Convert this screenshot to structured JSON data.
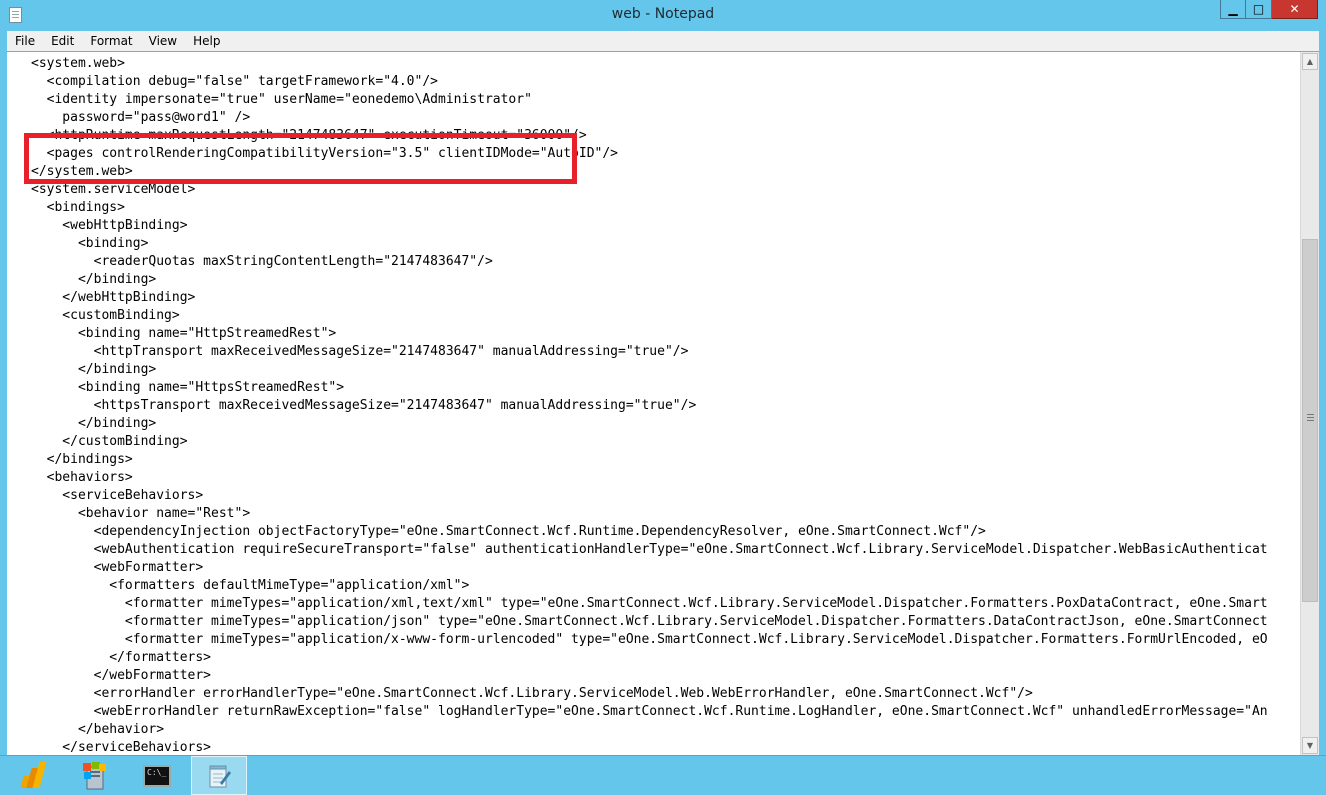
{
  "window": {
    "title": "web - Notepad",
    "controls": {
      "minimize": "▁",
      "maximize": "□",
      "close": "✕"
    }
  },
  "menu": [
    "File",
    "Edit",
    "Format",
    "View",
    "Help"
  ],
  "editor": {
    "lines": [
      "<system.web>",
      "  <compilation debug=\"false\" targetFramework=\"4.0\"/>",
      "  <identity impersonate=\"true\" userName=\"eonedemo\\Administrator\"",
      "    password=\"pass@word1\" />",
      "  <httpRuntime maxRequestLength=\"2147483647\" executionTimeout=\"36000\"/>",
      "  <pages controlRenderingCompatibilityVersion=\"3.5\" clientIDMode=\"AutoID\"/>",
      "</system.web>",
      "<system.serviceModel>",
      "  <bindings>",
      "    <webHttpBinding>",
      "      <binding>",
      "        <readerQuotas maxStringContentLength=\"2147483647\"/>",
      "      </binding>",
      "    </webHttpBinding>",
      "    <customBinding>",
      "      <binding name=\"HttpStreamedRest\">",
      "        <httpTransport maxReceivedMessageSize=\"2147483647\" manualAddressing=\"true\"/>",
      "      </binding>",
      "      <binding name=\"HttpsStreamedRest\">",
      "        <httpsTransport maxReceivedMessageSize=\"2147483647\" manualAddressing=\"true\"/>",
      "      </binding>",
      "    </customBinding>",
      "  </bindings>",
      "  <behaviors>",
      "    <serviceBehaviors>",
      "      <behavior name=\"Rest\">",
      "        <dependencyInjection objectFactoryType=\"eOne.SmartConnect.Wcf.Runtime.DependencyResolver, eOne.SmartConnect.Wcf\"/>",
      "        <webAuthentication requireSecureTransport=\"false\" authenticationHandlerType=\"eOne.SmartConnect.Wcf.Library.ServiceModel.Dispatcher.WebBasicAuthenticat",
      "        <webFormatter>",
      "          <formatters defaultMimeType=\"application/xml\">",
      "            <formatter mimeTypes=\"application/xml,text/xml\" type=\"eOne.SmartConnect.Wcf.Library.ServiceModel.Dispatcher.Formatters.PoxDataContract, eOne.Smart",
      "            <formatter mimeTypes=\"application/json\" type=\"eOne.SmartConnect.Wcf.Library.ServiceModel.Dispatcher.Formatters.DataContractJson, eOne.SmartConnect",
      "            <formatter mimeTypes=\"application/x-www-form-urlencoded\" type=\"eOne.SmartConnect.Wcf.Library.ServiceModel.Dispatcher.Formatters.FormUrlEncoded, eO",
      "          </formatters>",
      "        </webFormatter>",
      "        <errorHandler errorHandlerType=\"eOne.SmartConnect.Wcf.Library.ServiceModel.Web.WebErrorHandler, eOne.SmartConnect.Wcf\"/>",
      "        <webErrorHandler returnRawException=\"false\" logHandlerType=\"eOne.SmartConnect.Wcf.Runtime.LogHandler, eOne.SmartConnect.Wcf\" unhandledErrorMessage=\"An",
      "      </behavior>",
      "    </serviceBehaviors>"
    ]
  },
  "scrollbar": {
    "up_arrow": "▲",
    "down_arrow": "▼"
  },
  "taskbar": {
    "items": [
      {
        "icon": "dynamics-icon"
      },
      {
        "icon": "server-manager-icon"
      },
      {
        "icon": "command-prompt-icon",
        "text": "C:\\_"
      },
      {
        "icon": "notepad-icon"
      }
    ]
  },
  "colors": {
    "chrome": "#64c6ea",
    "highlight_box": "#e8202a",
    "close_button": "#c7372f"
  }
}
